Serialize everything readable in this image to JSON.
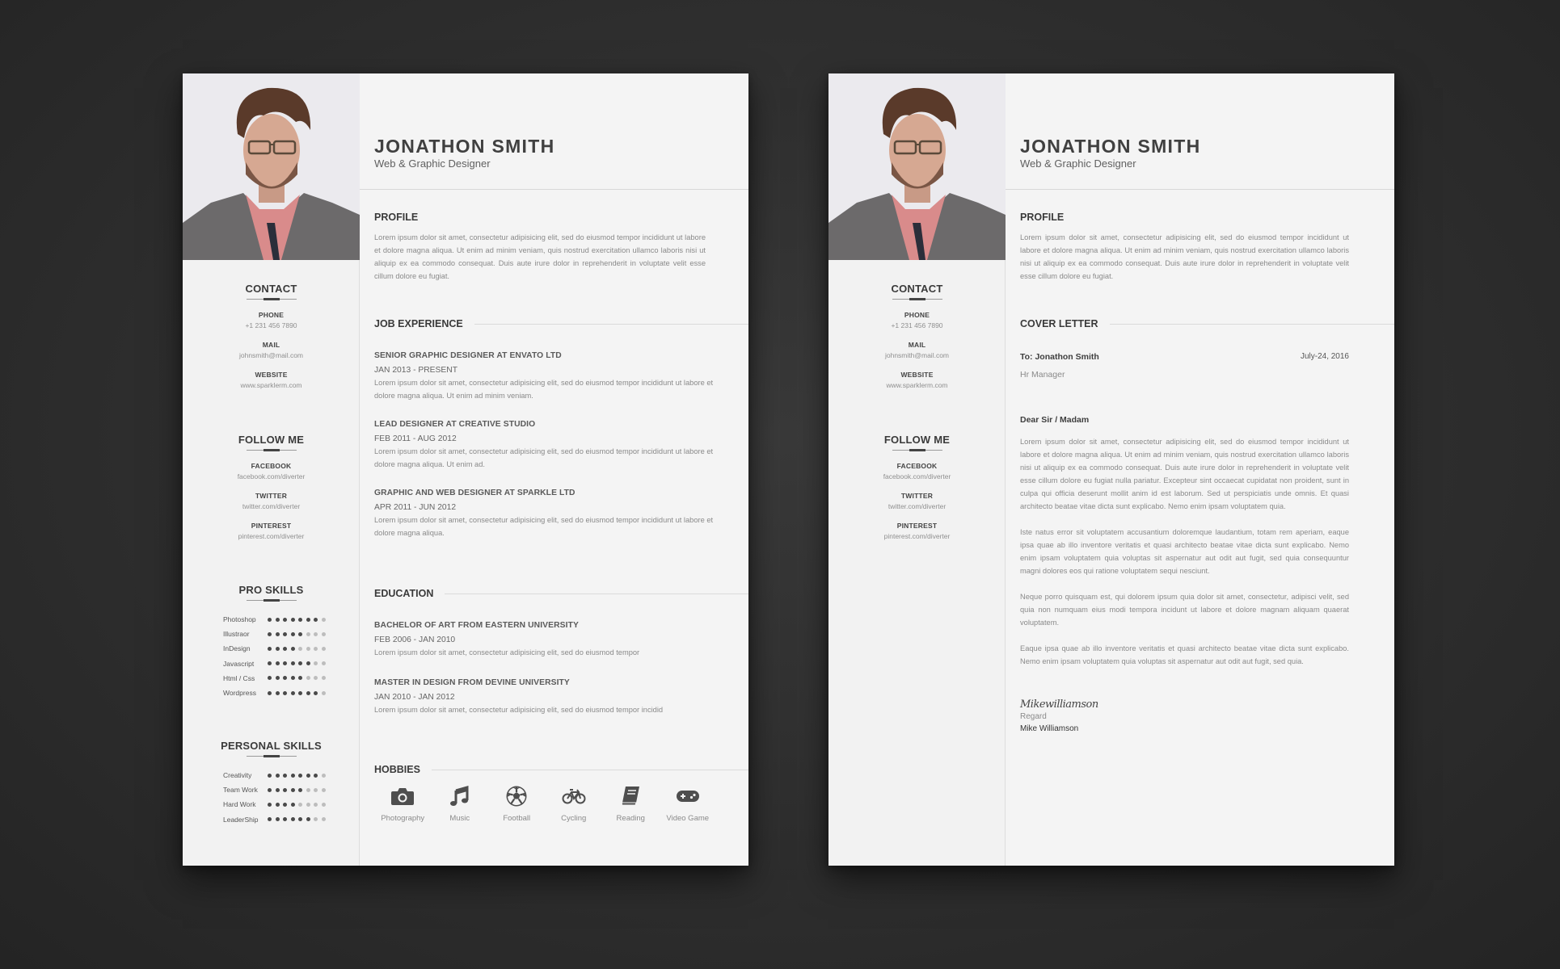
{
  "person": {
    "name": "JONATHON SMITH",
    "role": "Web & Graphic Designer"
  },
  "sidebar": {
    "contact": {
      "title": "CONTACT",
      "items": [
        {
          "label": "PHONE",
          "value": "+1 231 456 7890"
        },
        {
          "label": "MAIL",
          "value": "johnsmith@mail.com"
        },
        {
          "label": "WEBSITE",
          "value": "www.sparklerm.com"
        }
      ]
    },
    "follow": {
      "title": "FOLLOW ME",
      "items": [
        {
          "label": "FACEBOOK",
          "value": "facebook.com/diverter"
        },
        {
          "label": "TWITTER",
          "value": "twitter.com/diverter"
        },
        {
          "label": "PINTEREST",
          "value": "pinterest.com/diverter"
        }
      ]
    },
    "pro_skills": {
      "title": "PRO SKILLS",
      "max": 8,
      "items": [
        {
          "name": "Photoshop",
          "level": 7
        },
        {
          "name": "Illustraor",
          "level": 5
        },
        {
          "name": "InDesign",
          "level": 4
        },
        {
          "name": "Javascript",
          "level": 6
        },
        {
          "name": "Html / Css",
          "level": 5
        },
        {
          "name": "Wordpress",
          "level": 7
        }
      ]
    },
    "personal_skills": {
      "title": "PERSONAL SKILLS",
      "max": 8,
      "items": [
        {
          "name": "Creativity",
          "level": 7
        },
        {
          "name": "Team Work",
          "level": 5
        },
        {
          "name": "Hard Work",
          "level": 4
        },
        {
          "name": "LeaderShip",
          "level": 6
        }
      ]
    }
  },
  "resume": {
    "profile": {
      "title": "PROFILE",
      "text": "Lorem ipsum dolor sit amet, consectetur adipisicing elit, sed do eiusmod tempor incididunt ut labore et dolore magna aliqua. Ut enim ad minim veniam, quis nostrud exercitation ullamco laboris nisi ut aliquip ex ea commodo consequat. Duis aute irure dolor in reprehenderit in voluptate velit esse cillum dolore eu fugiat."
    },
    "experience": {
      "title": "JOB EXPERIENCE",
      "items": [
        {
          "title": "SENIOR GRAPHIC DESIGNER AT ENVATO LTD",
          "date": "JAN 2013 - PRESENT",
          "desc": "Lorem ipsum dolor sit amet, consectetur adipisicing elit, sed do eiusmod tempor incididunt ut labore et dolore magna aliqua. Ut enim ad minim veniam."
        },
        {
          "title": "LEAD DESIGNER AT CREATIVE STUDIO",
          "date": "FEB 2011 - AUG 2012",
          "desc": "Lorem ipsum dolor sit amet, consectetur adipisicing elit, sed do eiusmod tempor incididunt ut labore et dolore magna aliqua. Ut enim ad."
        },
        {
          "title": "GRAPHIC AND WEB DESIGNER AT SPARKLE LTD",
          "date": "APR 2011 - JUN 2012",
          "desc": "Lorem ipsum dolor sit amet, consectetur adipisicing elit, sed do eiusmod tempor incididunt ut labore et dolore magna aliqua."
        }
      ]
    },
    "education": {
      "title": "EDUCATION",
      "items": [
        {
          "title": "BACHELOR OF ART FROM EASTERN UNIVERSITY",
          "date": "FEB 2006 - JAN 2010",
          "desc": "Lorem ipsum dolor sit amet, consectetur adipisicing elit, sed do eiusmod tempor"
        },
        {
          "title": "MASTER IN DESIGN FROM DEVINE UNIVERSITY",
          "date": "JAN 2010 - JAN 2012",
          "desc": "Lorem ipsum dolor sit amet, consectetur adipisicing elit, sed do eiusmod tempor incidid"
        }
      ]
    },
    "hobbies": {
      "title": "HOBBIES",
      "items": [
        {
          "label": "Photography",
          "icon": "camera-icon"
        },
        {
          "label": "Music",
          "icon": "music-note-icon"
        },
        {
          "label": "Football",
          "icon": "soccer-ball-icon"
        },
        {
          "label": "Cycling",
          "icon": "bicycle-icon"
        },
        {
          "label": "Reading",
          "icon": "book-icon"
        },
        {
          "label": "Video Game",
          "icon": "gamepad-icon"
        }
      ]
    }
  },
  "cover": {
    "profile": {
      "title": "PROFILE",
      "text": "Lorem ipsum dolor sit amet, consectetur adipisicing elit, sed do eiusmod tempor incididunt ut labore et dolore magna aliqua. Ut enim ad minim veniam, quis nostrud exercitation ullamco laboris nisi ut aliquip ex ea commodo consequat. Duis aute irure dolor in reprehenderit in voluptate velit esse cillum dolore eu fugiat."
    },
    "letter": {
      "title": "COVER LETTER",
      "to": "To: Jonathon Smith",
      "date": "July-24, 2016",
      "recipient_role": "Hr Manager",
      "salutation": "Dear Sir / Madam",
      "paragraphs": [
        "Lorem ipsum dolor sit amet, consectetur adipisicing elit, sed do eiusmod tempor incididunt ut labore et dolore magna aliqua. Ut enim ad minim veniam, quis nostrud exercitation ullamco laboris nisi ut aliquip ex ea commodo consequat. Duis aute irure dolor in reprehenderit in voluptate velit esse cillum dolore eu fugiat nulla pariatur. Excepteur sint occaecat cupidatat non proident, sunt in culpa qui officia deserunt mollit anim id est laborum. Sed ut perspiciatis unde omnis. Et quasi architecto beatae vitae dicta sunt explicabo. Nemo enim ipsam voluptatem quia.",
        "Iste natus error sit voluptatem accusantium doloremque laudantium, totam rem aperiam, eaque ipsa quae ab illo inventore veritatis et quasi architecto beatae vitae dicta sunt explicabo. Nemo enim ipsam voluptatem quia voluptas sit aspernatur aut odit aut fugit, sed quia consequuntur magni dolores eos qui ratione voluptatem sequi nesciunt.",
        "Neque porro quisquam est, qui dolorem ipsum quia dolor sit amet, consectetur, adipisci velit, sed quia non numquam eius modi tempora incidunt ut labore et dolore magnam aliquam quaerat voluptatem.",
        "Eaque ipsa quae ab illo inventore veritatis et quasi architecto beatae vitae dicta sunt explicabo. Nemo enim ipsam voluptatem quia voluptas sit aspernatur aut odit aut fugit, sed quia."
      ],
      "signature": "Mikewilliamson",
      "closing": "Regard",
      "signer": "Mike Williamson"
    }
  },
  "colors": {
    "background": "#2e2e2e",
    "paper": "#f4f4f4",
    "heading": "#3a3a3a",
    "body_text": "#8a8a8a",
    "dot_on": "#4a4a4a",
    "dot_off": "#bdbdbd"
  }
}
